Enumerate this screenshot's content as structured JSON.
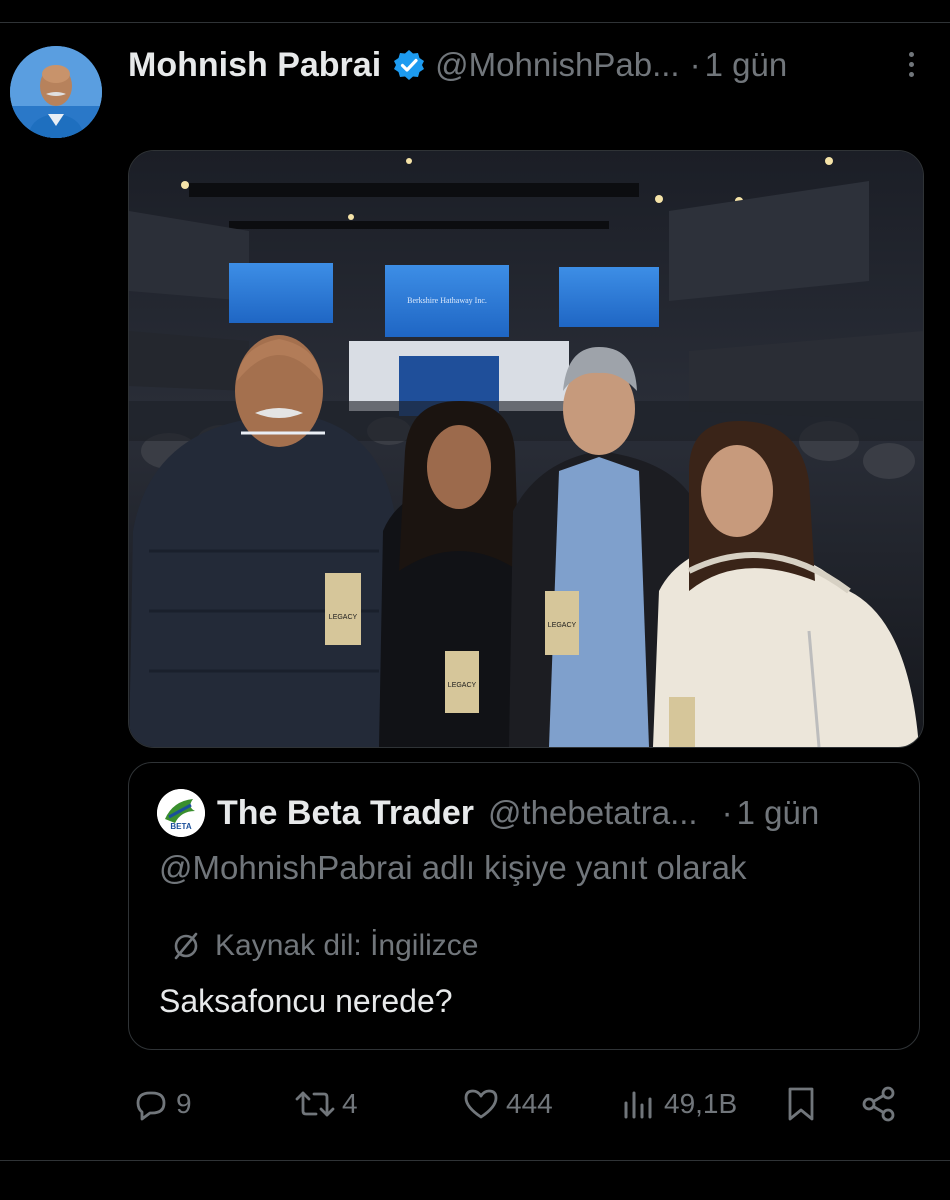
{
  "tweet": {
    "author_name": "Mohnish Pabrai",
    "handle": "@MohnishPab...",
    "separator": "·",
    "time": "1 gün",
    "verified_icon": "verified-badge-icon",
    "accent_color": "#1d9bf0"
  },
  "photo": {
    "screen_caption": "Berkshire Hathaway Inc.",
    "badge_text": "LEGACY"
  },
  "quote": {
    "author_name": "The Beta Trader",
    "handle": "@thebetatra...",
    "separator": "·",
    "time": "1 gün",
    "reply_context": "@MohnishPabrai adlı kişiye yanıt olarak",
    "language_note": "Kaynak dil: İngilizce",
    "text": "Saksafoncu nerede?",
    "avatar_text": "BETA"
  },
  "actions": {
    "replies": "9",
    "retweets": "4",
    "likes": "444",
    "views": "49,1B"
  }
}
